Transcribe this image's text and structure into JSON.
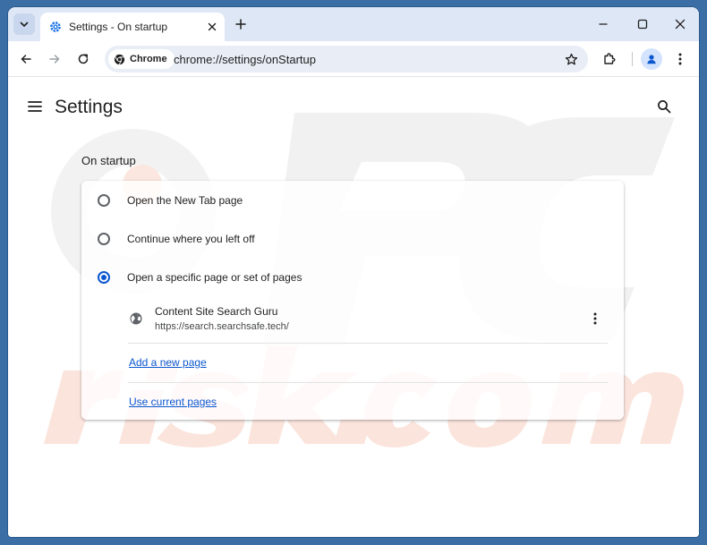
{
  "browser": {
    "tab_title": "Settings - On startup",
    "chip_label": "Chrome",
    "url": "chrome://settings/onStartup"
  },
  "settings": {
    "title": "Settings",
    "section_title": "On startup",
    "options": [
      {
        "label": "Open the New Tab page",
        "checked": false
      },
      {
        "label": "Continue where you left off",
        "checked": false
      },
      {
        "label": "Open a specific page or set of pages",
        "checked": true
      }
    ],
    "pages": [
      {
        "name": "Content Site Search Guru",
        "url": "https://search.searchsafe.tech/"
      }
    ],
    "add_page_label": "Add a new page",
    "use_current_label": "Use current pages"
  },
  "colors": {
    "accent": "#0b57d0",
    "titlebar": "#dee7f5",
    "omnibox": "#e9eef6"
  }
}
